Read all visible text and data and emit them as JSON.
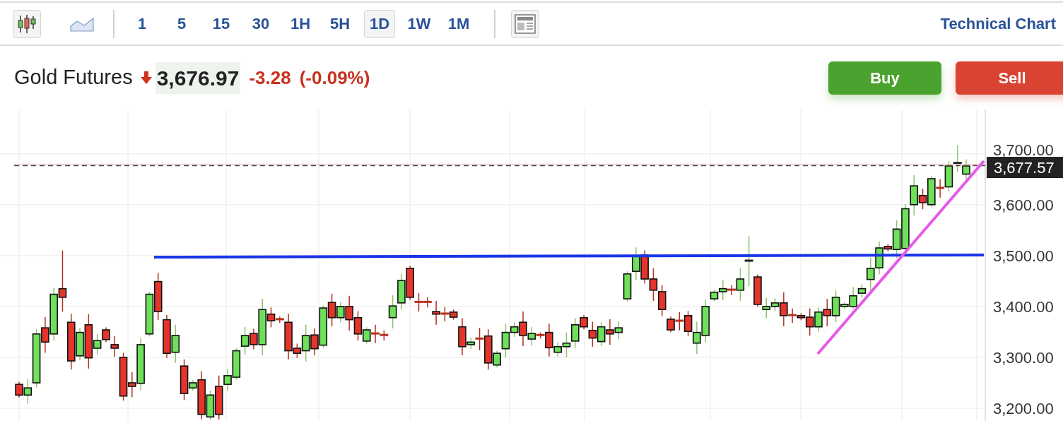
{
  "toolbar": {
    "chart_types": [
      {
        "kind": "candles",
        "selected": true
      },
      {
        "kind": "line",
        "selected": false
      }
    ],
    "intervals": [
      {
        "label": "1",
        "selected": false
      },
      {
        "label": "5",
        "selected": false
      },
      {
        "label": "15",
        "selected": false
      },
      {
        "label": "30",
        "selected": false
      },
      {
        "label": "1H",
        "selected": false
      },
      {
        "label": "5H",
        "selected": false
      },
      {
        "label": "1D",
        "selected": true
      },
      {
        "label": "1W",
        "selected": false
      },
      {
        "label": "1M",
        "selected": false
      }
    ],
    "link": "Technical Chart"
  },
  "quote": {
    "name": "Gold Futures",
    "down": true,
    "price": "3,676.97",
    "change": "-3.28",
    "change_percent": "(-0.09%)"
  },
  "buttons": [
    {
      "label": "Buy",
      "kind": "buy"
    },
    {
      "label": "Sell",
      "kind": "sell"
    }
  ],
  "chart": {
    "last_price": "3,677.57",
    "chart_data": {
      "type": "candlestick",
      "ylim": [
        3175,
        3787
      ],
      "grid": true,
      "yticks": [
        {
          "value": 3700,
          "label": "3,700.00"
        },
        {
          "value": 3600,
          "label": "3,600.00"
        },
        {
          "value": 3500,
          "label": "3,500.00"
        },
        {
          "value": 3400,
          "label": "3,400.00"
        },
        {
          "value": 3300,
          "label": "3,300.00"
        },
        {
          "value": 3200,
          "label": "3,200.00"
        }
      ],
      "ohlc": [
        [
          3247,
          3252,
          3221,
          3226
        ],
        [
          3226,
          3257,
          3209,
          3240
        ],
        [
          3250,
          3355,
          3241,
          3346
        ],
        [
          3358,
          3379,
          3309,
          3330
        ],
        [
          3346,
          3437,
          3333,
          3424
        ],
        [
          3435,
          3510,
          3390,
          3418
        ],
        [
          3369,
          3386,
          3276,
          3293
        ],
        [
          3303,
          3358,
          3294,
          3349
        ],
        [
          3364,
          3385,
          3278,
          3299
        ],
        [
          3318,
          3346,
          3305,
          3333
        ],
        [
          3354,
          3359,
          3330,
          3335
        ],
        [
          3325,
          3342,
          3301,
          3318
        ],
        [
          3300,
          3309,
          3215,
          3224
        ],
        [
          3250,
          3271,
          3222,
          3243
        ],
        [
          3249,
          3338,
          3236,
          3325
        ],
        [
          3346,
          3429,
          3341,
          3424
        ],
        [
          3449,
          3466,
          3373,
          3390
        ],
        [
          3374,
          3383,
          3299,
          3308
        ],
        [
          3310,
          3364,
          3289,
          3343
        ],
        [
          3283,
          3296,
          3216,
          3229
        ],
        [
          3240,
          3255,
          3235,
          3250
        ],
        [
          3256,
          3273,
          3178,
          3188
        ],
        [
          3183,
          3235,
          3178,
          3226
        ],
        [
          3243,
          3264,
          3178,
          3188
        ],
        [
          3247,
          3277,
          3234,
          3264
        ],
        [
          3261,
          3318,
          3256,
          3313
        ],
        [
          3322,
          3360,
          3305,
          3343
        ],
        [
          3347,
          3356,
          3316,
          3325
        ],
        [
          3325,
          3415,
          3304,
          3394
        ],
        [
          3385,
          3398,
          3359,
          3372
        ],
        [
          3375,
          3380,
          3368,
          3373
        ],
        [
          3369,
          3386,
          3296,
          3313
        ],
        [
          3318,
          3327,
          3299,
          3308
        ],
        [
          3313,
          3364,
          3292,
          3343
        ],
        [
          3344,
          3357,
          3304,
          3317
        ],
        [
          3324,
          3402,
          3319,
          3397
        ],
        [
          3408,
          3425,
          3361,
          3378
        ],
        [
          3378,
          3409,
          3369,
          3400
        ],
        [
          3400,
          3421,
          3353,
          3374
        ],
        [
          3378,
          3391,
          3333,
          3346
        ],
        [
          3332,
          3359,
          3327,
          3354
        ],
        [
          3347,
          3364,
          3328,
          3345
        ],
        [
          3344,
          3353,
          3333,
          3342
        ],
        [
          3378,
          3422,
          3357,
          3401
        ],
        [
          3407,
          3464,
          3394,
          3451
        ],
        [
          3475,
          3480,
          3413,
          3418
        ],
        [
          3409,
          3426,
          3390,
          3407
        ],
        [
          3409,
          3418,
          3398,
          3407
        ],
        [
          3390,
          3411,
          3364,
          3385
        ],
        [
          3386,
          3399,
          3371,
          3384
        ],
        [
          3389,
          3394,
          3374,
          3379
        ],
        [
          3360,
          3377,
          3304,
          3321
        ],
        [
          3325,
          3339,
          3316,
          3330
        ],
        [
          3337,
          3358,
          3314,
          3335
        ],
        [
          3342,
          3355,
          3276,
          3289
        ],
        [
          3285,
          3313,
          3280,
          3308
        ],
        [
          3317,
          3366,
          3300,
          3349
        ],
        [
          3349,
          3369,
          3340,
          3360
        ],
        [
          3369,
          3390,
          3322,
          3343
        ],
        [
          3336,
          3360,
          3323,
          3347
        ],
        [
          3344,
          3349,
          3337,
          3342
        ],
        [
          3349,
          3366,
          3302,
          3319
        ],
        [
          3310,
          3330,
          3301,
          3321
        ],
        [
          3321,
          3349,
          3300,
          3328
        ],
        [
          3332,
          3377,
          3319,
          3364
        ],
        [
          3378,
          3383,
          3355,
          3360
        ],
        [
          3353,
          3370,
          3321,
          3338
        ],
        [
          3331,
          3369,
          3322,
          3360
        ],
        [
          3354,
          3375,
          3325,
          3346
        ],
        [
          3349,
          3371,
          3336,
          3358
        ],
        [
          3415,
          3469,
          3410,
          3464
        ],
        [
          3469,
          3516,
          3452,
          3499
        ],
        [
          3501,
          3510,
          3445,
          3454
        ],
        [
          3454,
          3475,
          3411,
          3432
        ],
        [
          3429,
          3442,
          3381,
          3394
        ],
        [
          3375,
          3380,
          3349,
          3354
        ],
        [
          3372,
          3389,
          3353,
          3370
        ],
        [
          3382,
          3391,
          3342,
          3351
        ],
        [
          3328,
          3370,
          3307,
          3349
        ],
        [
          3343,
          3413,
          3330,
          3400
        ],
        [
          3415,
          3433,
          3410,
          3428
        ],
        [
          3429,
          3452,
          3412,
          3435
        ],
        [
          3433,
          3442,
          3422,
          3431
        ],
        [
          3432,
          3475,
          3411,
          3454
        ],
        [
          3488,
          3538,
          3440,
          3490
        ],
        [
          3458,
          3463,
          3399,
          3404
        ],
        [
          3394,
          3417,
          3377,
          3400
        ],
        [
          3400,
          3416,
          3391,
          3407
        ],
        [
          3407,
          3428,
          3361,
          3382
        ],
        [
          3383,
          3396,
          3368,
          3381
        ],
        [
          3382,
          3387,
          3373,
          3378
        ],
        [
          3379,
          3396,
          3343,
          3360
        ],
        [
          3360,
          3398,
          3351,
          3389
        ],
        [
          3394,
          3415,
          3361,
          3382
        ],
        [
          3382,
          3431,
          3369,
          3418
        ],
        [
          3400,
          3409,
          3395,
          3404
        ],
        [
          3400,
          3438,
          3396,
          3421
        ],
        [
          3426,
          3444,
          3417,
          3435
        ],
        [
          3453,
          3496,
          3432,
          3475
        ],
        [
          3476,
          3528,
          3463,
          3515
        ],
        [
          3518,
          3523,
          3508,
          3513
        ],
        [
          3512,
          3569,
          3495,
          3552
        ],
        [
          3514,
          3601,
          3511,
          3592
        ],
        [
          3600,
          3658,
          3579,
          3637
        ],
        [
          3618,
          3631,
          3591,
          3604
        ],
        [
          3600,
          3656,
          3595,
          3651
        ],
        [
          3633,
          3650,
          3614,
          3631
        ],
        [
          3635,
          3685,
          3626,
          3676
        ],
        [
          3680,
          3717,
          3665,
          3682
        ],
        [
          3660,
          3689,
          3647,
          3676
        ]
      ]
    }
  }
}
